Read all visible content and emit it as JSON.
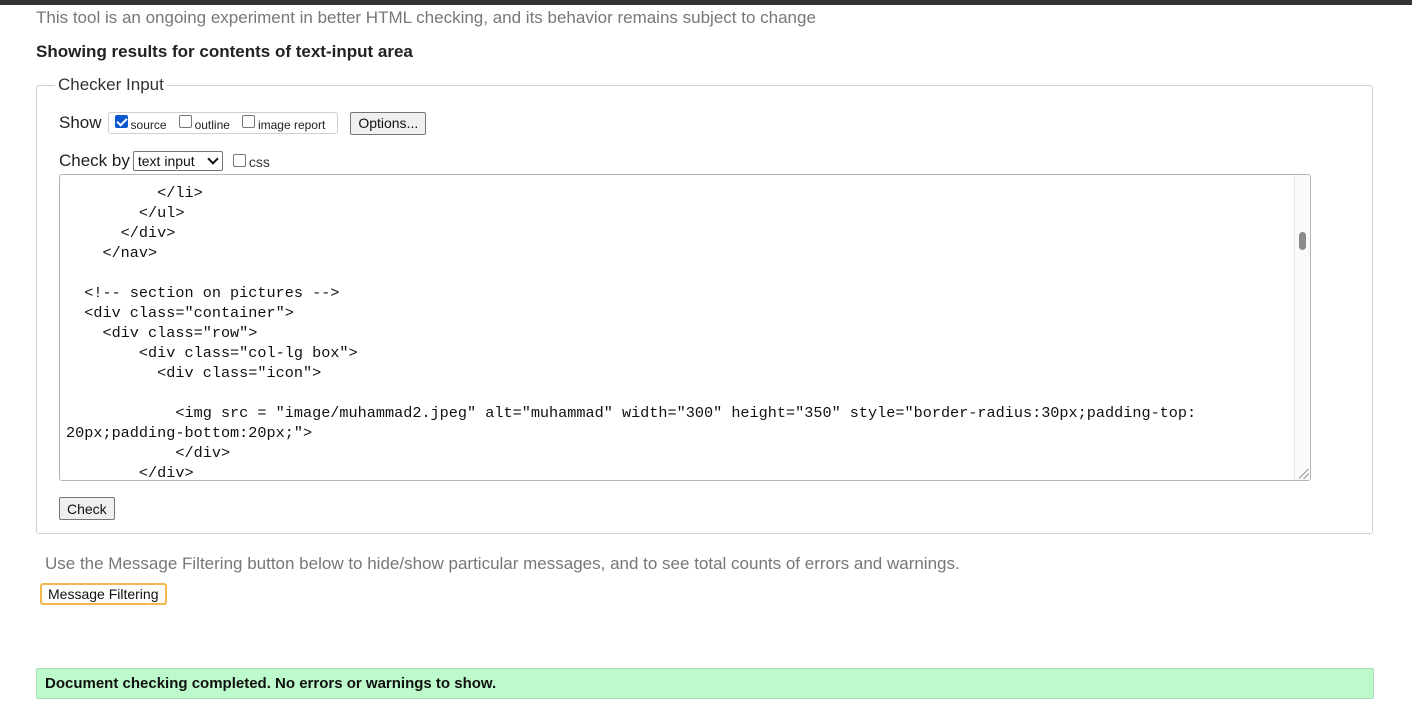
{
  "notice": "This tool is an ongoing experiment in better HTML checking, and its behavior remains subject to change",
  "results_heading": "Showing results for contents of text-input area",
  "checker_input": {
    "legend": "Checker Input",
    "show_label": "Show",
    "show_options": [
      {
        "label": "source",
        "checked": true
      },
      {
        "label": "outline",
        "checked": false
      },
      {
        "label": "image report",
        "checked": false
      }
    ],
    "options_button": "Options...",
    "check_by_label": "Check by",
    "check_by_selected": "text input",
    "css_label": "css",
    "css_checked": false,
    "source_lines": [
      "",
      "          </li>",
      "        </ul>",
      "      </div>",
      "    </nav>",
      "",
      "  <!-- section on pictures -->",
      "  <div class=\"container\">",
      "    <div class=\"row\">",
      "        <div class=\"col-lg box\">",
      "          <div class=\"icon\">",
      "",
      "            <img src = \"image/muhammad2.jpeg\" alt=\"muhammad\" width=\"300\" height=\"350\" style=\"border-radius:30px;padding-top:",
      "20px;padding-bottom:20px;\">",
      "            </div>",
      "        </div>"
    ],
    "check_button": "Check"
  },
  "filter_help": "Use the Message Filtering button below to hide/show particular messages, and to see total counts of errors and warnings.",
  "filter_button": "Message Filtering",
  "success_message": "Document checking completed. No errors or warnings to show."
}
